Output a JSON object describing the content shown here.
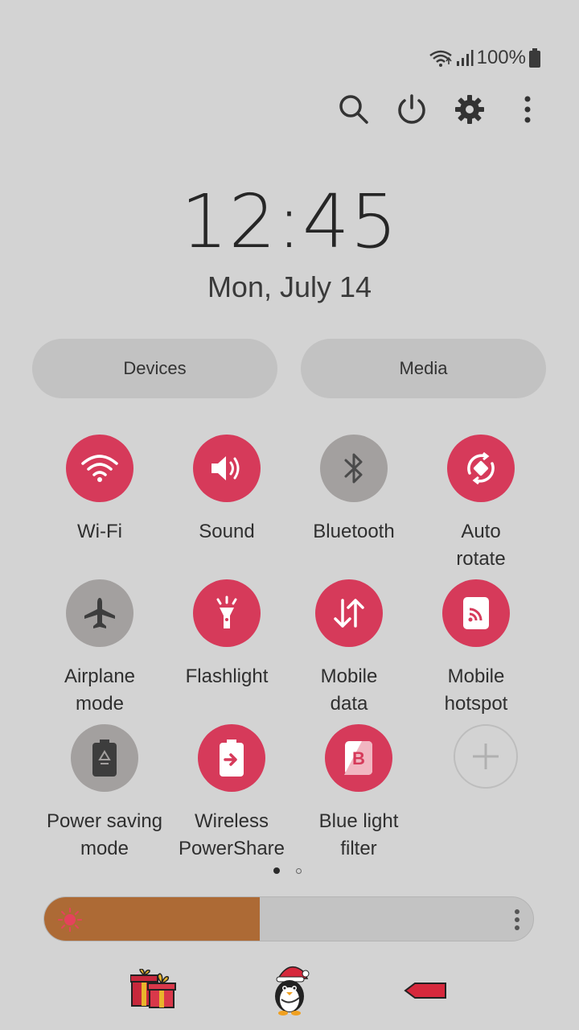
{
  "status": {
    "battery_text": "100%",
    "icons": [
      "wifi-icon",
      "signal-icon",
      "battery-icon"
    ]
  },
  "toolbar": {
    "icons": [
      "search-icon",
      "power-icon",
      "gear-icon",
      "more-vert-icon"
    ]
  },
  "clock": {
    "time": "12:45",
    "date": "Mon, July 14"
  },
  "pills": {
    "devices": "Devices",
    "media": "Media"
  },
  "tiles": [
    {
      "label": "Wi-Fi",
      "icon": "wifi-icon",
      "state": "on"
    },
    {
      "label": "Sound",
      "icon": "speaker-icon",
      "state": "on"
    },
    {
      "label": "Bluetooth",
      "icon": "bluetooth-icon",
      "state": "off"
    },
    {
      "label": "Auto\nrotate",
      "icon": "auto-rotate-icon",
      "state": "on"
    },
    {
      "label": "Airplane\nmode",
      "icon": "airplane-icon",
      "state": "off"
    },
    {
      "label": "Flashlight",
      "icon": "flashlight-icon",
      "state": "on"
    },
    {
      "label": "Mobile\ndata",
      "icon": "mobile-data-icon",
      "state": "on"
    },
    {
      "label": "Mobile\nhotspot",
      "icon": "hotspot-icon",
      "state": "on"
    },
    {
      "label": "Power saving\nmode",
      "icon": "power-saving-icon",
      "state": "off"
    },
    {
      "label": "Wireless\nPowerShare",
      "icon": "wireless-powershare-icon",
      "state": "on"
    },
    {
      "label": "Blue light\nfilter",
      "icon": "blue-light-filter-icon",
      "state": "on"
    },
    {
      "label": "",
      "icon": "add-icon",
      "state": "add"
    }
  ],
  "pager": {
    "pages": 2,
    "current": 1
  },
  "brightness": {
    "level": 0.44
  },
  "colors": {
    "accent": "#d63a5a",
    "inactive": "#a3a09f",
    "background": "#d3d3d3",
    "brightness_fill": "#ad6a35"
  },
  "bottom": {
    "icons": [
      "gift-icon",
      "penguin-icon",
      "arrow-tag-icon"
    ]
  }
}
